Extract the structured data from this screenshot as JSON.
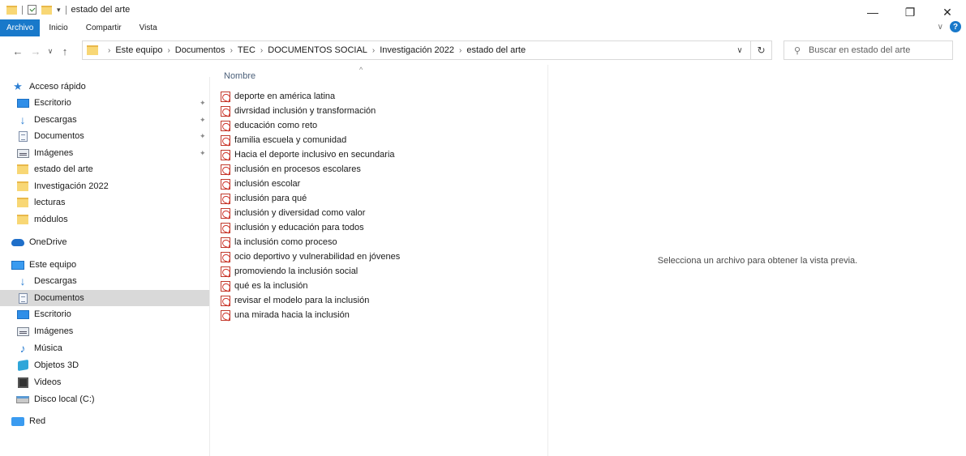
{
  "window": {
    "title": "estado del arte",
    "controls": {
      "minimize": "—",
      "restore": "❐",
      "close": "✕"
    }
  },
  "ribbon": {
    "tabs": [
      {
        "label": "Archivo",
        "active": true
      },
      {
        "label": "Inicio"
      },
      {
        "label": "Compartir"
      },
      {
        "label": "Vista"
      }
    ],
    "expand_glyph": "∨",
    "help_glyph": "?"
  },
  "address": {
    "back_glyph": "←",
    "forward_glyph": "→",
    "recent_glyph": "∨",
    "up_glyph": "↑",
    "breadcrumbs": [
      "Este equipo",
      "Documentos",
      "TEC",
      "DOCUMENTOS SOCIAL",
      "Investigación 2022",
      "estado del arte"
    ],
    "separator": "›",
    "dropdown_glyph": "∨",
    "refresh_glyph": "↻"
  },
  "search": {
    "placeholder": "Buscar en estado del arte",
    "icon_glyph": "⚲"
  },
  "nav": {
    "quick_access": {
      "label": "Acceso rápido",
      "icon": "star-icon"
    },
    "pinned": [
      {
        "label": "Escritorio",
        "icon": "desktop-icon",
        "pinned": true
      },
      {
        "label": "Descargas",
        "icon": "download-icon",
        "pinned": true
      },
      {
        "label": "Documentos",
        "icon": "documents-icon",
        "pinned": true
      },
      {
        "label": "Imágenes",
        "icon": "pictures-icon",
        "pinned": true
      },
      {
        "label": "estado del arte",
        "icon": "folder-icon"
      },
      {
        "label": "Investigación 2022",
        "icon": "folder-icon"
      },
      {
        "label": "lecturas",
        "icon": "folder-icon"
      },
      {
        "label": "módulos",
        "icon": "folder-icon"
      }
    ],
    "onedrive": {
      "label": "OneDrive",
      "icon": "onedrive-icon"
    },
    "this_pc": {
      "label": "Este equipo",
      "icon": "computer-icon"
    },
    "this_pc_items": [
      {
        "label": "Descargas",
        "icon": "download-icon"
      },
      {
        "label": "Documentos",
        "icon": "documents-icon",
        "selected": true
      },
      {
        "label": "Escritorio",
        "icon": "desktop-icon"
      },
      {
        "label": "Imágenes",
        "icon": "pictures-icon"
      },
      {
        "label": "Música",
        "icon": "music-icon"
      },
      {
        "label": "Objetos 3D",
        "icon": "objects-3d-icon"
      },
      {
        "label": "Videos",
        "icon": "videos-icon"
      },
      {
        "label": "Disco local (C:)",
        "icon": "disk-icon"
      }
    ],
    "network": {
      "label": "Red",
      "icon": "network-icon"
    },
    "pin_glyph": "✦"
  },
  "file_list": {
    "column": "Nombre",
    "sort_glyph": "^",
    "files": [
      "deporte en américa latina",
      "divrsidad inclusión y transformación",
      "educación como reto",
      "familia escuela y comunidad",
      "Hacia el deporte inclusivo en secundaria",
      "inclusión en procesos escolares",
      "inclusión escolar",
      "inclusión para qué",
      "inclusión y diversidad como valor",
      "inclusión y educación para todos",
      "la inclusión como proceso",
      "ocio deportivo y vulnerabilidad en jóvenes",
      "promoviendo la inclusión social",
      "qué es la inclusión",
      "revisar el modelo para la inclusión",
      "una mirada hacia la inclusión"
    ]
  },
  "preview": {
    "message": "Selecciona un archivo para obtener la vista previa."
  }
}
